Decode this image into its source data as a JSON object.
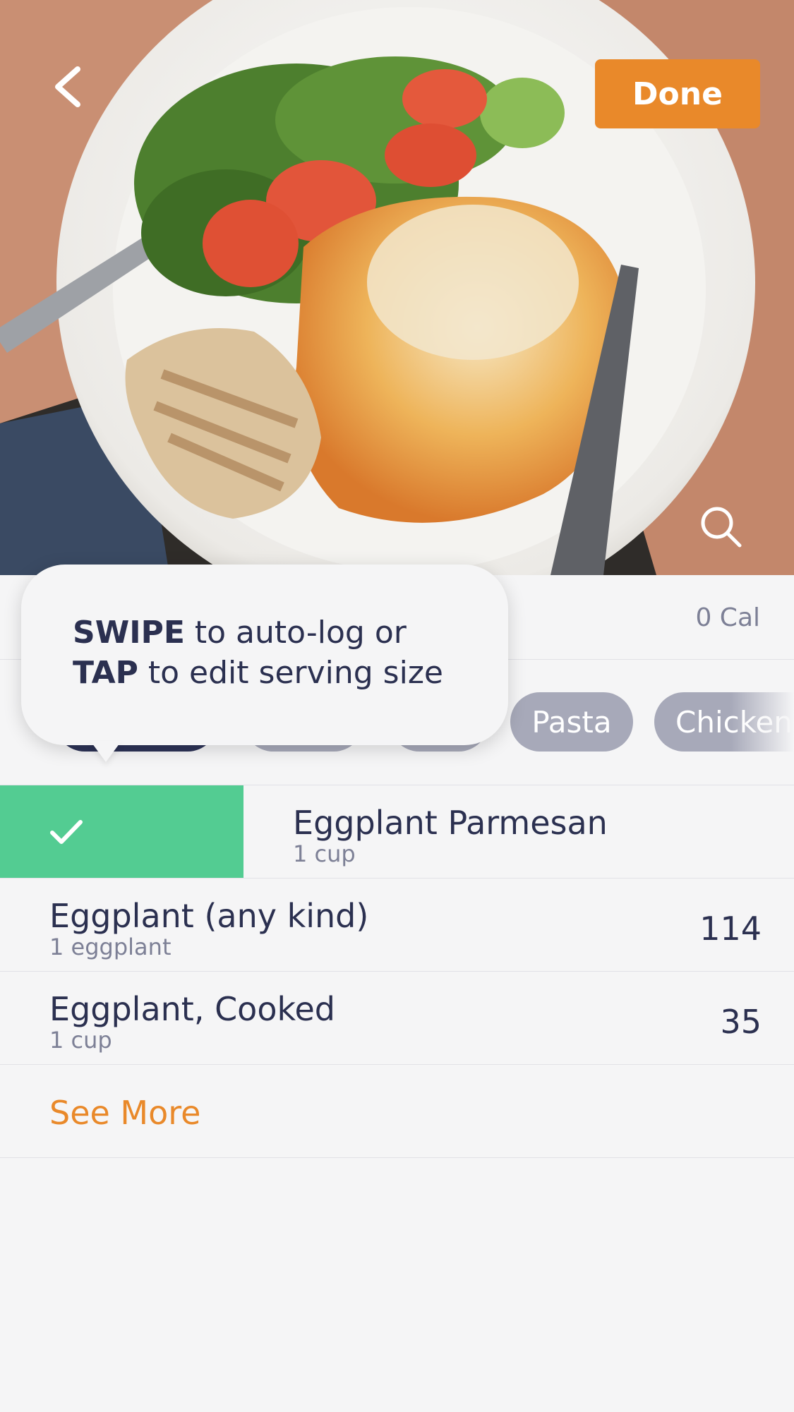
{
  "header": {
    "done_label": "Done"
  },
  "meal": {
    "calories_label": "0 Cal"
  },
  "chips": [
    "Pasta",
    "Chicken"
  ],
  "tooltip": {
    "line1_bold": "SWIPE",
    "line1_rest": " to auto-log or",
    "line2_bold": "TAP",
    "line2_rest": " to edit serving size"
  },
  "foods": [
    {
      "name": "Eggplant Parmesan",
      "serving": "1 cup",
      "calories": ""
    },
    {
      "name": "Eggplant (any kind)",
      "serving": "1 eggplant",
      "calories": "114"
    },
    {
      "name": "Eggplant, Cooked",
      "serving": "1 cup",
      "calories": "35"
    }
  ],
  "see_more_label": "See More",
  "colors": {
    "accent": "#e9892a",
    "swipe_green": "#53cc92",
    "navy": "#2d3357",
    "chip_gray": "#a7a9b9"
  },
  "icons": [
    "back-chevron-icon",
    "search-icon",
    "checkmark-icon"
  ]
}
